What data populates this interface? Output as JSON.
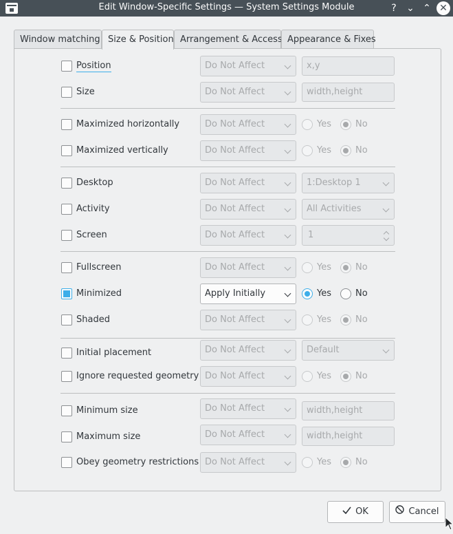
{
  "window": {
    "title": "Edit Window-Specific Settings — System Settings Module",
    "help_glyph": "?",
    "minimize_glyph": "⌄",
    "maximize_glyph": "⌃",
    "close_glyph": "✕"
  },
  "tabs": [
    {
      "label": "Window matching"
    },
    {
      "label": "Size & Position"
    },
    {
      "label": "Arrangement & Access"
    },
    {
      "label": "Appearance & Fixes"
    }
  ],
  "rows": {
    "position": {
      "label": "Position",
      "checked": false,
      "policy": "Do Not Affect",
      "placeholder": "x,y"
    },
    "size": {
      "label": "Size",
      "checked": false,
      "policy": "Do Not Affect",
      "placeholder": "width,height"
    },
    "max_h": {
      "label": "Maximized horizontally",
      "checked": false,
      "policy": "Do Not Affect",
      "yes": "Yes",
      "no": "No"
    },
    "max_v": {
      "label": "Maximized vertically",
      "checked": false,
      "policy": "Do Not Affect",
      "yes": "Yes",
      "no": "No"
    },
    "desktop": {
      "label": "Desktop",
      "checked": false,
      "policy": "Do Not Affect",
      "value": "1:Desktop 1"
    },
    "activity": {
      "label": "Activity",
      "checked": false,
      "policy": "Do Not Affect",
      "value": "All Activities"
    },
    "screen": {
      "label": "Screen",
      "checked": false,
      "policy": "Do Not Affect",
      "value": "1"
    },
    "fullscreen": {
      "label": "Fullscreen",
      "checked": false,
      "policy": "Do Not Affect",
      "yes": "Yes",
      "no": "No"
    },
    "minimized": {
      "label": "Minimized",
      "checked": true,
      "policy": "Apply Initially",
      "yes": "Yes",
      "no": "No"
    },
    "shaded": {
      "label": "Shaded",
      "checked": false,
      "policy": "Do Not Affect",
      "yes": "Yes",
      "no": "No"
    },
    "placement": {
      "label": "Initial placement",
      "checked": false,
      "policy": "Do Not Affect",
      "value": "Default"
    },
    "ignore_geom": {
      "label": "Ignore requested geometry",
      "checked": false,
      "policy": "Do Not Affect",
      "yes": "Yes",
      "no": "No"
    },
    "min_size": {
      "label": "Minimum size",
      "checked": false,
      "policy": "Do Not Affect",
      "placeholder": "width,height"
    },
    "max_size": {
      "label": "Maximum size",
      "checked": false,
      "policy": "Do Not Affect",
      "placeholder": "width,height"
    },
    "obey_geom": {
      "label": "Obey geometry restrictions",
      "checked": false,
      "policy": "Do Not Affect",
      "yes": "Yes",
      "no": "No"
    }
  },
  "buttons": {
    "ok": "OK",
    "cancel": "Cancel"
  },
  "colors": {
    "accent": "#3daee9",
    "titlebar": "#475057",
    "window_bg": "#eff0f1"
  }
}
